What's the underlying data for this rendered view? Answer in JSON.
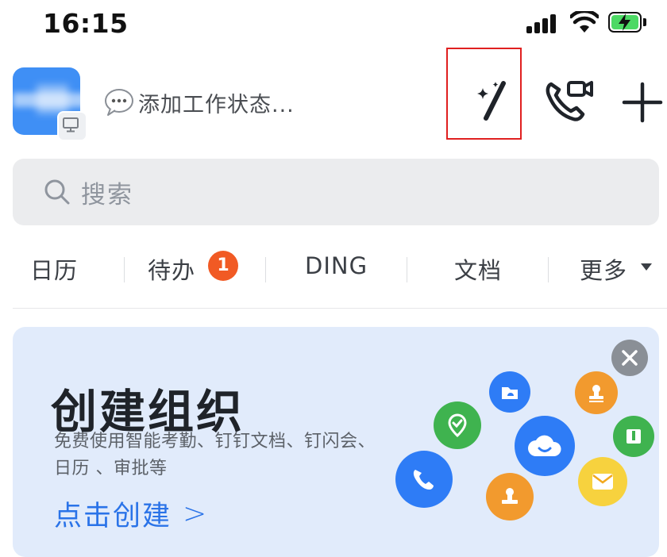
{
  "status_bar": {
    "time": "16:15"
  },
  "header": {
    "status_placeholder": "添加工作状态..."
  },
  "search": {
    "placeholder": "搜索"
  },
  "tabs": [
    {
      "label": "日历"
    },
    {
      "label": "待办",
      "badge": "1"
    },
    {
      "label": "DING"
    },
    {
      "label": "文档"
    },
    {
      "label": "更多"
    }
  ],
  "banner": {
    "title": "创建组织",
    "description_line1": "免费使用智能考勤、钉钉文档、钉闪会、",
    "description_line2": "日历 、审批等",
    "cta": "点击创建",
    "cta_arrow": ">"
  },
  "colors": {
    "accent_blue": "#2a73e8",
    "badge_red": "#f15a24",
    "card_bg": "#e1ebfb",
    "highlight_box": "#e02020"
  },
  "icons": {
    "status_bar": [
      "cellular-signal-icon",
      "wifi-icon",
      "battery-charging-icon"
    ],
    "header": [
      "ai-magic-wand-icon",
      "phone-video-call-icon",
      "plus-icon"
    ],
    "banner_bubbles": [
      "cloud-drive-icon",
      "approval-stamp-icon",
      "location-check-icon",
      "cloud-smile-icon",
      "book-icon",
      "phone-call-icon",
      "stamp-icon",
      "mail-icon"
    ]
  }
}
